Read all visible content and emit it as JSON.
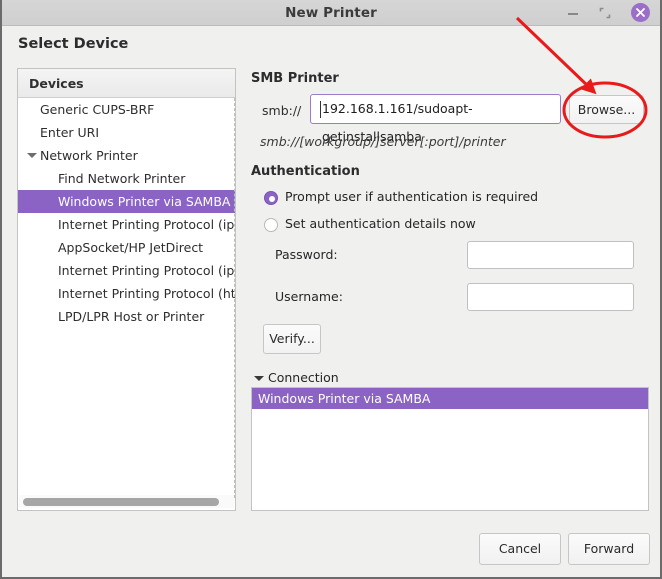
{
  "window": {
    "title": "New Printer",
    "controls": {
      "minimize": "minimize-icon",
      "maximize": "maximize-icon",
      "close": "close-icon"
    }
  },
  "page": {
    "title": "Select Device"
  },
  "devices": {
    "header": "Devices",
    "items": [
      {
        "label": "Generic CUPS-BRF",
        "indent": 1,
        "selected": false,
        "expander": false
      },
      {
        "label": "Enter URI",
        "indent": 1,
        "selected": false,
        "expander": false
      },
      {
        "label": "Network Printer",
        "indent": 1,
        "selected": false,
        "expander": true
      },
      {
        "label": "Find Network Printer",
        "indent": 2,
        "selected": false,
        "expander": false
      },
      {
        "label": "Windows Printer via SAMBA",
        "indent": 2,
        "selected": true,
        "expander": false
      },
      {
        "label": "Internet Printing Protocol (ipp)",
        "indent": 2,
        "selected": false,
        "expander": false
      },
      {
        "label": "AppSocket/HP JetDirect",
        "indent": 2,
        "selected": false,
        "expander": false
      },
      {
        "label": "Internet Printing Protocol (ipps)",
        "indent": 2,
        "selected": false,
        "expander": false
      },
      {
        "label": "Internet Printing Protocol (http)",
        "indent": 2,
        "selected": false,
        "expander": false
      },
      {
        "label": "LPD/LPR Host or Printer",
        "indent": 2,
        "selected": false,
        "expander": false
      }
    ]
  },
  "smb": {
    "section_title": "SMB Printer",
    "prefix_label": "smb://",
    "uri_value": "192.168.1.161/sudoapt-getinstallsamba",
    "browse_label": "Browse...",
    "hint": "smb://[workgroup/]server[:port]/printer"
  },
  "authentication": {
    "section_title": "Authentication",
    "option_prompt": "Prompt user if authentication is required",
    "option_setnow": "Set authentication details now",
    "selected_option": "prompt",
    "password_label": "Password:",
    "password_value": "",
    "username_label": "Username:",
    "username_value": "",
    "verify_label": "Verify..."
  },
  "connection": {
    "toggle_label": "Connection",
    "expanded": true,
    "items": [
      {
        "label": "Windows Printer via SAMBA",
        "selected": true
      }
    ]
  },
  "footer": {
    "cancel_label": "Cancel",
    "forward_label": "Forward"
  },
  "annotation": {
    "color": "#e81a1a",
    "shapes": "arrow-and-ellipse-over-browse-button"
  },
  "colors": {
    "accent_selection": "#8a63c4",
    "window_close": "#9b6fc8",
    "annotation_red": "#e81a1a",
    "dialog_background": "#f0f0ef"
  }
}
